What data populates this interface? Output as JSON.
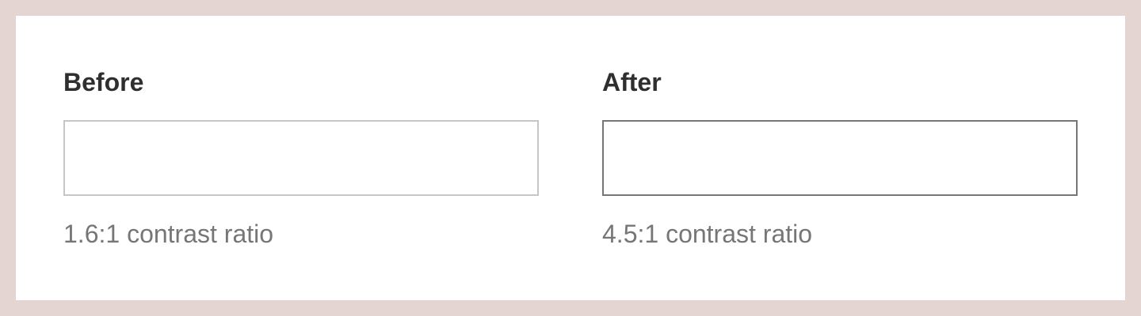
{
  "before": {
    "heading": "Before",
    "input_value": "",
    "border_color": "#c6c6c6",
    "caption": "1.6:1 contrast ratio"
  },
  "after": {
    "heading": "After",
    "input_value": "",
    "border_color": "#767676",
    "caption": "4.5:1 contrast ratio"
  },
  "colors": {
    "page_background": "#e4d5d3",
    "card_background": "#ffffff",
    "heading_text": "#2f2f2f",
    "caption_text": "#767676"
  }
}
